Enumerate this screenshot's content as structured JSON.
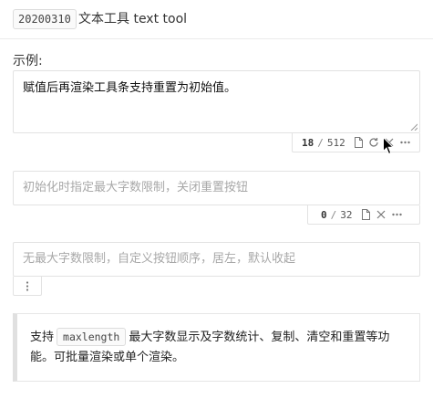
{
  "header": {
    "version": "20200310",
    "title": "文本工具 text tool"
  },
  "example_label": "示例:",
  "editor1": {
    "value": "赋值后再渲染工具条支持重置为初始值。",
    "count_current": "18",
    "count_separator": "/",
    "count_max": "512",
    "icons": [
      "copy-icon",
      "reset-icon",
      "clear-icon",
      "more-icon"
    ]
  },
  "editor2": {
    "placeholder": "初始化时指定最大字数限制，关闭重置按钮",
    "count_current": "0",
    "count_separator": "/",
    "count_max": "32",
    "icons": [
      "copy-icon",
      "clear-icon",
      "more-icon"
    ]
  },
  "editor3": {
    "placeholder": "无最大字数限制，自定义按钮顺序，居左，默认收起",
    "icons": [
      "more-vertical-icon"
    ]
  },
  "notice": {
    "prefix": "支持",
    "code": "maxlength",
    "suffix": "最大字数显示及字数统计、复制、清空和重置等功能。可批量渲染或单个渲染。"
  }
}
